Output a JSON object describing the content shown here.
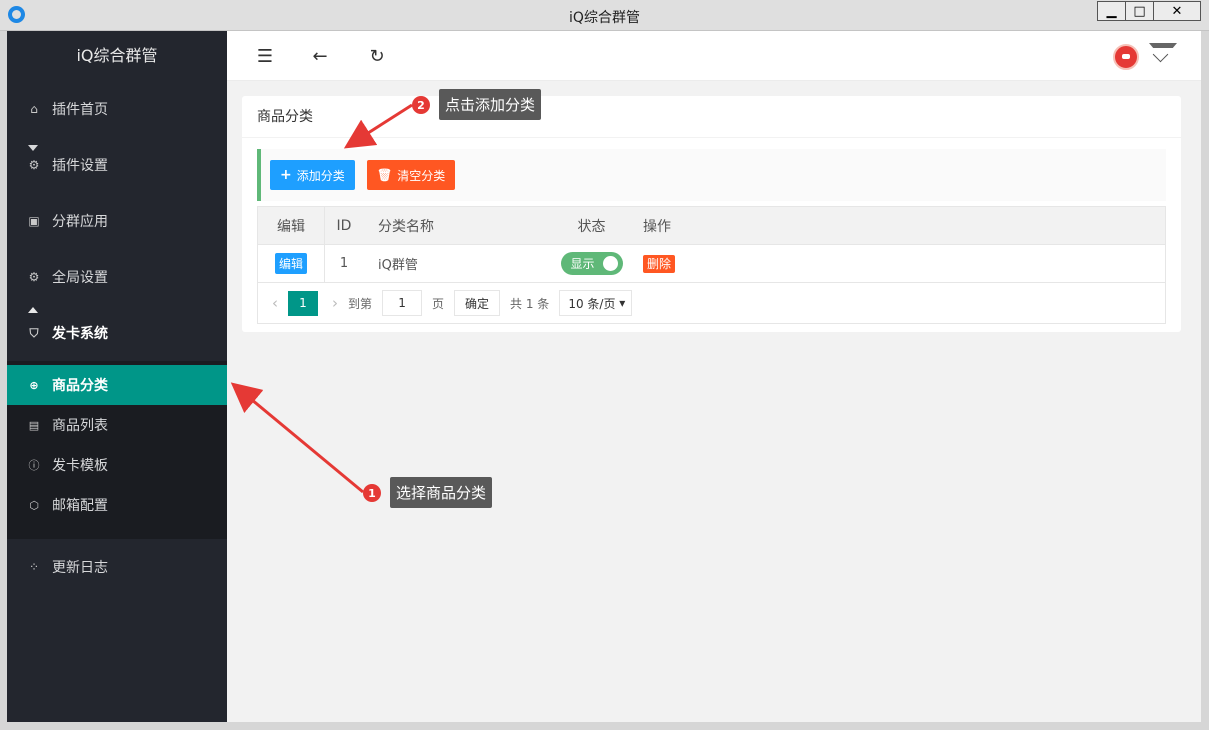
{
  "window": {
    "title": "iQ综合群管"
  },
  "sidebar": {
    "brand": "iQ综合群管",
    "items": [
      {
        "label": "插件首页",
        "icon": "home-icon"
      },
      {
        "label": "插件设置",
        "icon": "gear-icon"
      },
      {
        "label": "分群应用",
        "icon": "apps-icon"
      },
      {
        "label": "全局设置",
        "icon": "gear-icon"
      },
      {
        "label": "发卡系统",
        "icon": "shield-icon"
      }
    ],
    "sub_items": [
      {
        "label": "商品分类",
        "icon": "plus-circle-icon",
        "active": true
      },
      {
        "label": "商品列表",
        "icon": "chart-icon"
      },
      {
        "label": "发卡模板",
        "icon": "info-circle-icon"
      },
      {
        "label": "邮箱配置",
        "icon": "cube-icon"
      }
    ],
    "footer_item": {
      "label": "更新日志",
      "icon": "loading-icon"
    }
  },
  "card": {
    "title": "商品分类",
    "add_label": "添加分类",
    "clear_label": "清空分类"
  },
  "table": {
    "headers": [
      "编辑",
      "ID",
      "分类名称",
      "状态",
      "操作"
    ],
    "rows": [
      {
        "edit": "编辑",
        "id": "1",
        "name": "iQ群管",
        "status": "显示",
        "action": "删除"
      }
    ]
  },
  "pager": {
    "current": "1",
    "goto_label": "到第",
    "goto_value": "1",
    "page_label": "页",
    "confirm": "确定",
    "total": "共 1 条",
    "page_size": "10 条/页"
  },
  "annotations": {
    "step1_num": "1",
    "step1_text": "选择商品分类",
    "step2_num": "2",
    "step2_text": "点击添加分类"
  }
}
